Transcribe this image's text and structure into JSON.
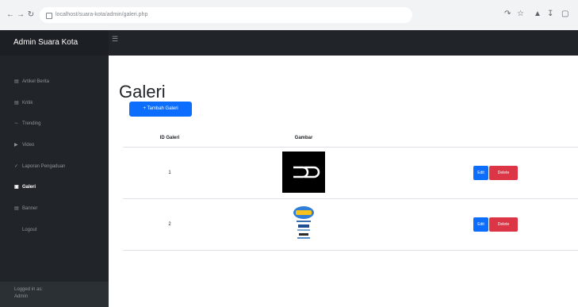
{
  "browser": {
    "url": "localhost/suara-kota/admin/galeri.php",
    "icons": [
      "back-icon",
      "forward-icon",
      "reload-icon",
      "lock-icon",
      "share-icon",
      "star-icon",
      "extension-icon",
      "download-icon",
      "sidebar-icon"
    ]
  },
  "sidebar": {
    "brand": "Admin Suara Kota",
    "items": [
      {
        "label": "Artikel Berita",
        "icon": "newspaper-icon",
        "active": false
      },
      {
        "label": "Kritik",
        "icon": "comment-icon",
        "active": false
      },
      {
        "label": "Trending",
        "icon": "trend-icon",
        "active": false
      },
      {
        "label": "Video",
        "icon": "video-icon",
        "active": false
      },
      {
        "label": "Laporan Pengaduan",
        "icon": "report-icon",
        "active": false
      },
      {
        "label": "Galeri",
        "icon": "image-icon",
        "active": true
      },
      {
        "label": "Banner",
        "icon": "banner-icon",
        "active": false
      },
      {
        "label": "Logout",
        "icon": "",
        "active": false
      }
    ],
    "footer_line1": "Logged in as:",
    "footer_line2": "Admin"
  },
  "main": {
    "title": "Galeri",
    "add_button": "+ Tambah Galeri",
    "table": {
      "headers": [
        "ID Galeri",
        "Gambar",
        ""
      ],
      "rows": [
        {
          "id": "1",
          "image": "black-logo",
          "edit": "Edit",
          "delete": "Delete"
        },
        {
          "id": "2",
          "image": "colorful-poster",
          "edit": "Edit",
          "delete": "Delete"
        }
      ]
    }
  },
  "colors": {
    "sidebar": "#212529",
    "primary": "#0d6efd",
    "danger": "#dc3545"
  }
}
